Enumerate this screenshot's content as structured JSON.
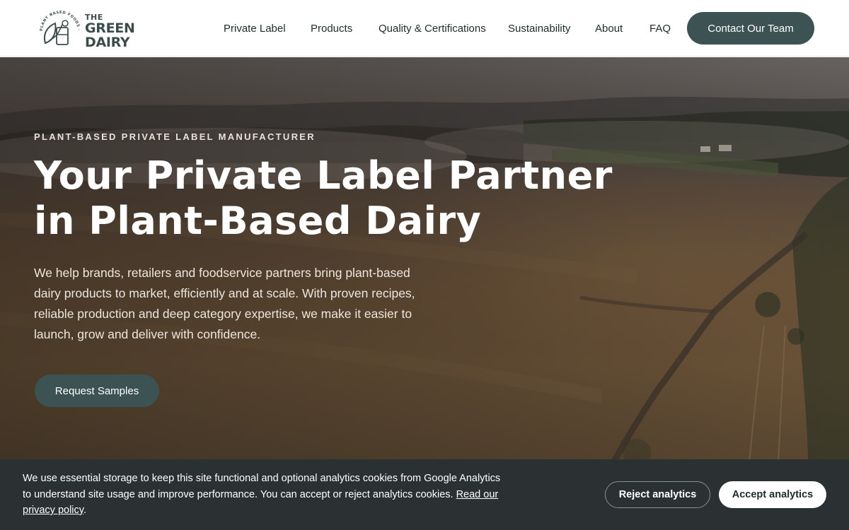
{
  "brand": {
    "logo_small": "THE",
    "logo_line1": "GREEN",
    "logo_line2": "DAIRY",
    "logo_ring_text": "PLANT BASED FOODS · EST. 2020",
    "color": "#3d5353"
  },
  "nav": {
    "items": [
      {
        "label": "Private Label"
      },
      {
        "label": "Products"
      },
      {
        "label": "Quality & Certifications"
      },
      {
        "label": "Sustainability"
      },
      {
        "label": "About"
      },
      {
        "label": "FAQ"
      }
    ],
    "cta_label": "Contact Our Team"
  },
  "hero": {
    "eyebrow": "PLANT-BASED PRIVATE LABEL MANUFACTURER",
    "headline_line1": "Your Private Label Partner",
    "headline_line2": "in Plant-Based Dairy",
    "lead": "We help brands, retailers and foodservice partners bring plant-based dairy products to market, efficiently and at scale. With proven recipes, reliable production and deep category expertise, we make it easier to launch, grow and deliver with confidence.",
    "cta_label": "Request Samples"
  },
  "cookie_banner": {
    "text": "We use essential storage to keep this site functional and optional analytics cookies from Google Analytics to understand site usage and improve performance. You can accept or reject analytics cookies.",
    "link_label": "Read our privacy policy",
    "text_end": ".",
    "reject_label": "Reject analytics",
    "accept_label": "Accept analytics",
    "background": "#2b3032"
  }
}
